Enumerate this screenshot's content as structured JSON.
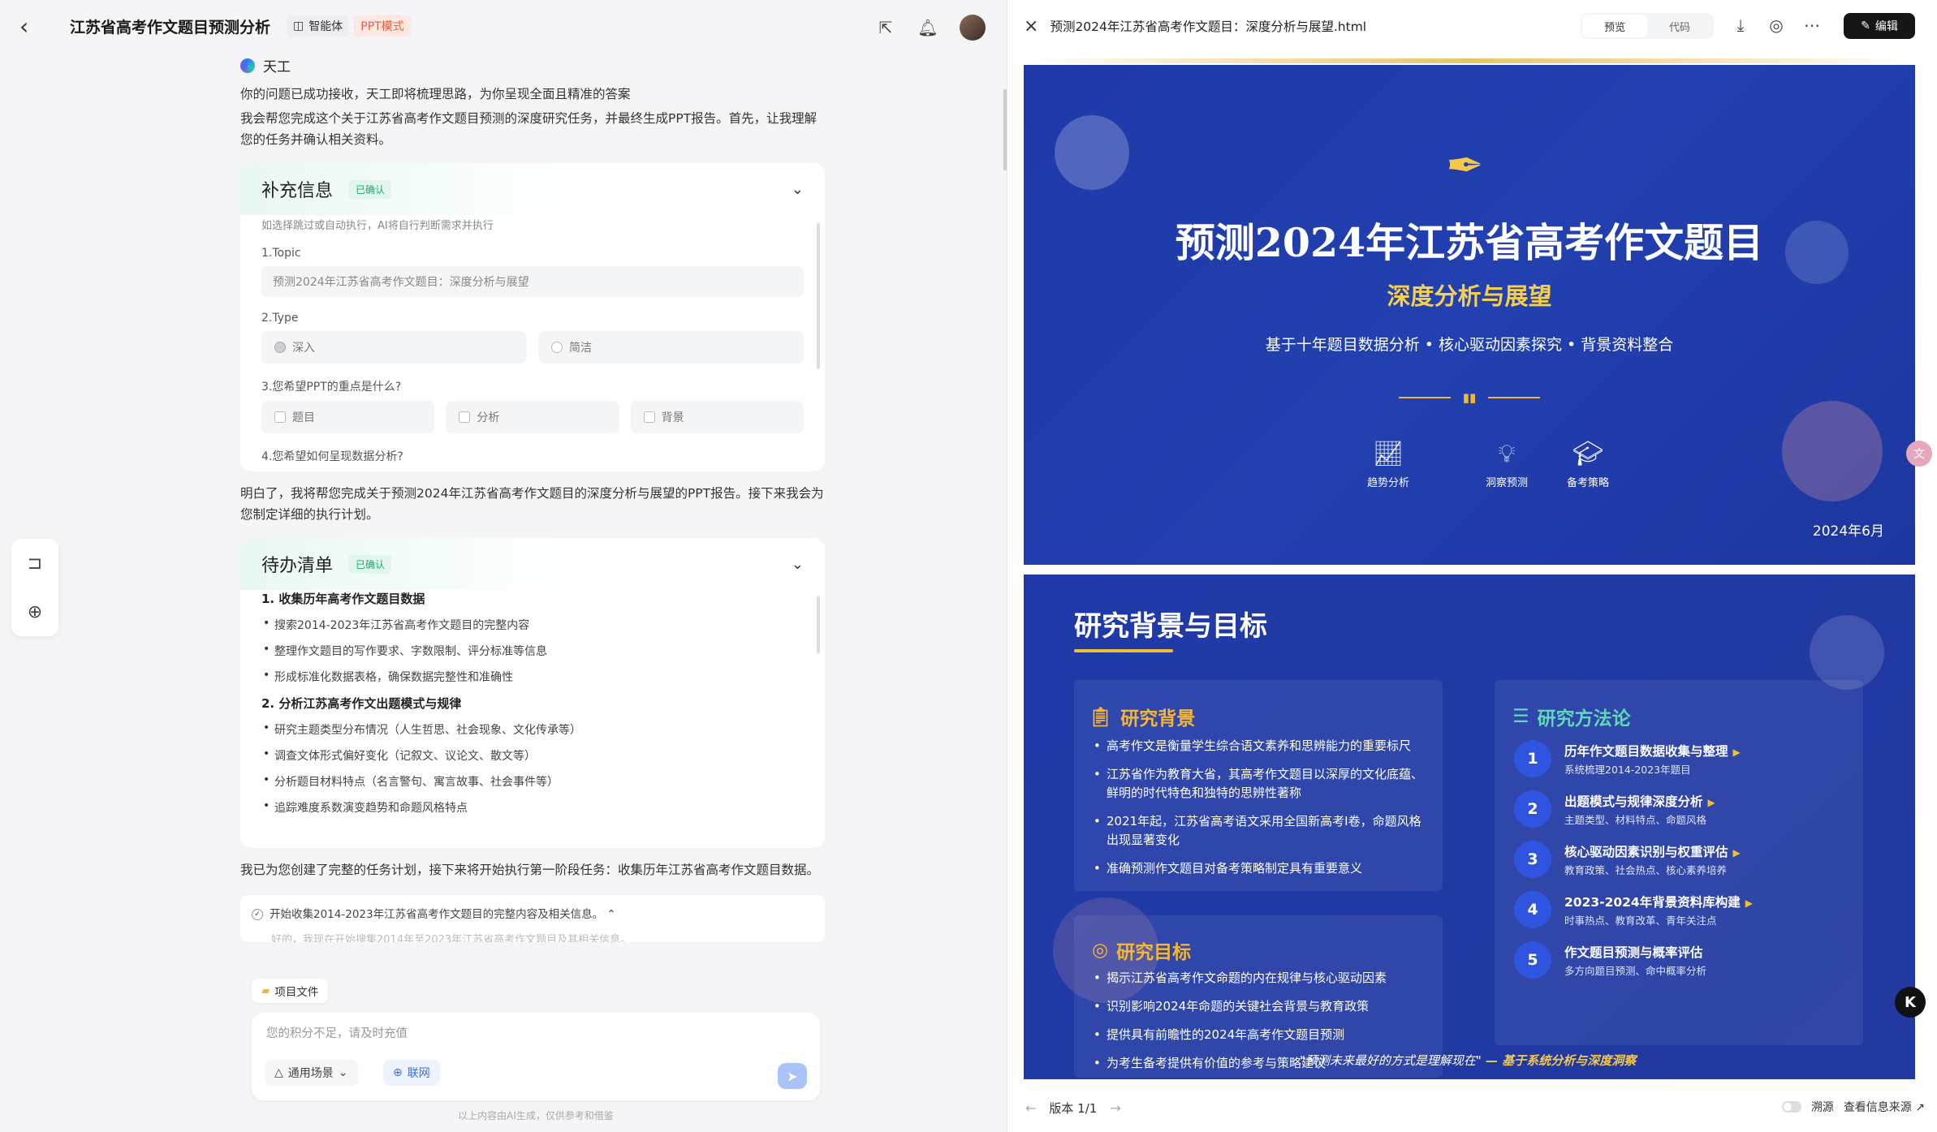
{
  "header": {
    "title": "江苏省高考作文题目预测分析",
    "agent_tag": "智能体",
    "mode_tag": "PPT模式"
  },
  "chat": {
    "bot_name": "天工",
    "msg1": "你的问题已成功接收，天工即将梳理思路，为你呈现全面且精准的答案",
    "msg2": "我会帮您完成这个关于江苏省高考作文题目预测的深度研究任务，并最终生成PPT报告。首先，让我理解您的任务并确认相关资料。",
    "info_card": {
      "title": "补充信息",
      "badge": "已确认",
      "hint": "如选择跳过或自动执行，AI将自行判断需求并执行",
      "q1_label": "1.Topic",
      "q1_value": "预测2024年江苏省高考作文题目：深度分析与展望",
      "q2_label": "2.Type",
      "q2_options": [
        "深入",
        "简洁"
      ],
      "q3_label": "3.您希望PPT的重点是什么?",
      "q3_options": [
        "题目",
        "分析",
        "背景"
      ],
      "q4_label": "4.您希望如何呈现数据分析?"
    },
    "msg3": "明白了，我将帮您完成关于预测2024年江苏省高考作文题目的深度分析与展望的PPT报告。接下来我会为您制定详细的执行计划。",
    "todo_card": {
      "title": "待办清单",
      "badge": "已确认",
      "s1": "1. 收集历年高考作文题目数据",
      "s1_items": [
        "搜索2014-2023年江苏省高考作文题目的完整内容",
        "整理作文题目的写作要求、字数限制、评分标准等信息",
        "形成标准化数据表格，确保数据完整性和准确性"
      ],
      "s2": "2. 分析江苏高考作文出题模式与规律",
      "s2_items": [
        "研究主题类型分布情况（人生哲思、社会现象、文化传承等）",
        "调查文体形式偏好变化（记叙文、议论文、散文等）",
        "分析题目材料特点（名言警句、寓言故事、社会事件等）",
        "追踪难度系数演变趋势和命题风格特点"
      ]
    },
    "msg4": "我已为您创建了完整的任务计划，接下来将开始执行第一阶段任务：收集历年江苏省高考作文题目数据。",
    "exec_step": "开始收集2014-2023年江苏省高考作文题目的完整内容及相关信息。",
    "exec_faded": "好的，我现在开始搜集2014年至2023年江苏省高考作文题目及其相关信息。"
  },
  "composer": {
    "project_file": "项目文件",
    "placeholder": "您的积分不足，请及时充值",
    "scene_label": "通用场景",
    "net_label": "联网",
    "footer": "以上内容由AI生成，仅供参考和借鉴"
  },
  "right": {
    "file_name": "预测2024年江苏省高考作文题目：深度分析与展望.html",
    "tab_preview": "预览",
    "tab_code": "代码",
    "edit_label": "编辑",
    "version": "版本 1/1",
    "source_label": "溯源",
    "info_source": "查看信息来源"
  },
  "slide1": {
    "title": "预测2024年江苏省高考作文题目",
    "subtitle": "深度分析与展望",
    "desc": "基于十年题目数据分析 • 核心驱动因素探究 • 背景资料整合",
    "icons": [
      "趋势分析",
      "洞察预测",
      "备考策略"
    ],
    "date": "2024年6月"
  },
  "slide2": {
    "title": "研究背景与目标",
    "bg_title": "研究背景",
    "bg_items": [
      "高考作文是衡量学生综合语文素养和思辨能力的重要标尺",
      "江苏省作为教育大省，其高考作文题目以深厚的文化底蕴、鲜明的时代特色和独特的思辨性著称",
      "2021年起，江苏省高考语文采用全国新高考Ⅰ卷，命题风格出现显著变化",
      "准确预测作文题目对备考策略制定具有重要意义"
    ],
    "goal_title": "研究目标",
    "goal_items": [
      "揭示江苏省高考作文命题的内在规律与核心驱动因素",
      "识别影响2024年命题的关键社会背景与教育政策",
      "提供具有前瞻性的2024年高考作文题目预测",
      "为考生备考提供有价值的参考与策略建议"
    ],
    "method_title": "研究方法论",
    "steps": [
      {
        "n": "1",
        "t": "历年作文题目数据收集与整理",
        "d": "系统梳理2014-2023年题目"
      },
      {
        "n": "2",
        "t": "出题模式与规律深度分析",
        "d": "主题类型、材料特点、命题风格"
      },
      {
        "n": "3",
        "t": "核心驱动因素识别与权重评估",
        "d": "教育政策、社会热点、核心素养培养"
      },
      {
        "n": "4",
        "t": "2023-2024年背景资料库构建",
        "d": "时事热点、教育改革、青年关注点"
      },
      {
        "n": "5",
        "t": "作文题目预测与概率评估",
        "d": "多方向题目预测、命中概率分析"
      }
    ],
    "quote": "\"预测未来最好的方式是理解现在\"",
    "quote_src": " — 基于系统分析与深度洞察"
  },
  "colors": {
    "accent": "#2340b0",
    "gold": "#f5c84a",
    "teal": "#5ed8b6",
    "edit_btn": "#161616"
  }
}
